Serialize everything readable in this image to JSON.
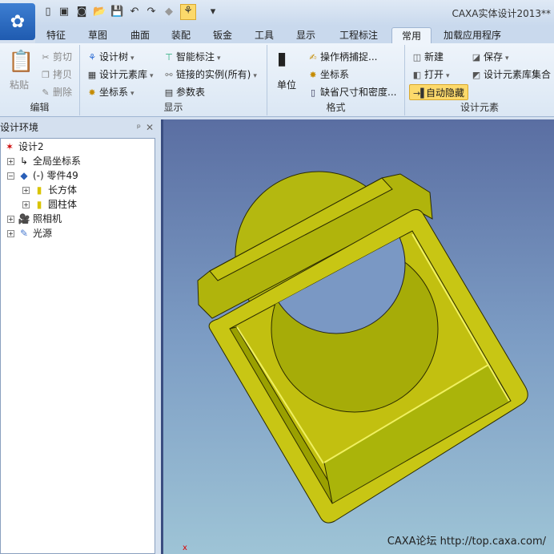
{
  "window": {
    "title": "CAXA实体设计2013**"
  },
  "quick_access": [
    {
      "icon": "new-icon",
      "glyph": "▯"
    },
    {
      "icon": "open-red-icon",
      "glyph": "▣"
    },
    {
      "icon": "template-icon",
      "glyph": "◙"
    },
    {
      "icon": "folder-icon",
      "glyph": "📂"
    },
    {
      "icon": "save-icon",
      "glyph": "💾"
    },
    {
      "icon": "undo-icon",
      "glyph": "↶"
    },
    {
      "icon": "redo-icon",
      "glyph": "↷"
    },
    {
      "icon": "render-icon",
      "glyph": "◆"
    },
    {
      "icon": "design-tree-icon",
      "glyph": "⚘"
    },
    {
      "icon": "customize-dropdown",
      "glyph": "▾"
    }
  ],
  "tabs": [
    "特征",
    "草图",
    "曲面",
    "装配",
    "钣金",
    "工具",
    "显示",
    "工程标注",
    "常用",
    "加载应用程序"
  ],
  "active_tab": "常用",
  "ribbon": {
    "edit": {
      "label": "编辑",
      "paste": "粘贴",
      "cut": "剪切",
      "copy": "拷贝",
      "delete": "删除"
    },
    "display": {
      "label": "显示",
      "design_tree": "设计树",
      "element_lib": "设计元素库",
      "coord": "坐标系",
      "smart_dim": "智能标注",
      "linked": "链接的实例(所有)",
      "param_table": "参数表"
    },
    "format": {
      "label": "格式",
      "unit": "单位",
      "handle_snap": "操作柄捕捉...",
      "coord": "坐标系",
      "default_size": "缺省尺寸和密度..."
    },
    "design_elements": {
      "label": "设计元素",
      "new": "新建",
      "save": "保存",
      "open": "打开",
      "lib_set": "设计元素库集合",
      "auto_hide": "自动隐藏"
    }
  },
  "panel": {
    "title": "设计环境",
    "pin": "ᵖ",
    "close": "✕",
    "tree": [
      {
        "label": "设计2",
        "toggle": ""
      },
      {
        "label": "全局坐标系",
        "toggle": "+"
      },
      {
        "label": "(-) 零件49",
        "toggle": "−"
      },
      {
        "label": "长方体",
        "toggle": "+"
      },
      {
        "label": "圆柱体",
        "toggle": "+"
      },
      {
        "label": "照相机",
        "toggle": "+"
      },
      {
        "label": "光源",
        "toggle": "+"
      }
    ]
  },
  "viewport": {
    "watermark": "CAXA论坛 http://top.caxa.com/",
    "axis_label": "x",
    "model_color": "#c6c40e"
  }
}
